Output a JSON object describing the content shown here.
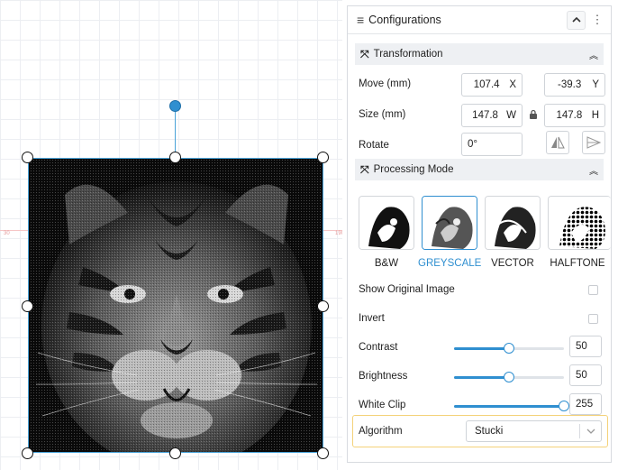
{
  "canvas": {
    "ruler_left": "30",
    "ruler_right": "190",
    "image_icon": "tiger-image"
  },
  "panel": {
    "title": "Configurations",
    "menu_icon": "hamburger-icon",
    "collapse_icon": "chevron-up-icon",
    "more_icon": "more-vertical-icon"
  },
  "transformation": {
    "title": "Transformation",
    "move_label": "Move (mm)",
    "move_x": "107.4",
    "move_x_unit": "X",
    "move_y": "-39.3",
    "move_y_unit": "Y",
    "size_label": "Size (mm)",
    "size_w": "147.8",
    "size_w_unit": "W",
    "size_h": "147.8",
    "size_h_unit": "H",
    "rotate_label": "Rotate",
    "rotate_value": "0°"
  },
  "processing": {
    "title": "Processing Mode",
    "modes": [
      {
        "label": "B&W"
      },
      {
        "label": "GREYSCALE"
      },
      {
        "label": "VECTOR"
      },
      {
        "label": "HALFTONE"
      }
    ],
    "selected_mode": "GREYSCALE",
    "show_original_label": "Show Original Image",
    "show_original_checked": false,
    "invert_label": "Invert",
    "invert_checked": false,
    "contrast_label": "Contrast",
    "contrast_value": "50",
    "contrast_level": 0.5,
    "brightness_label": "Brightness",
    "brightness_value": "50",
    "brightness_level": 0.5,
    "white_clip_label": "White Clip",
    "white_clip_value": "255",
    "white_clip_level": 1.0,
    "algorithm_label": "Algorithm",
    "algorithm_value": "Stucki"
  },
  "colors": {
    "accent": "#2f8fd0",
    "highlight": "#f4d27a"
  }
}
